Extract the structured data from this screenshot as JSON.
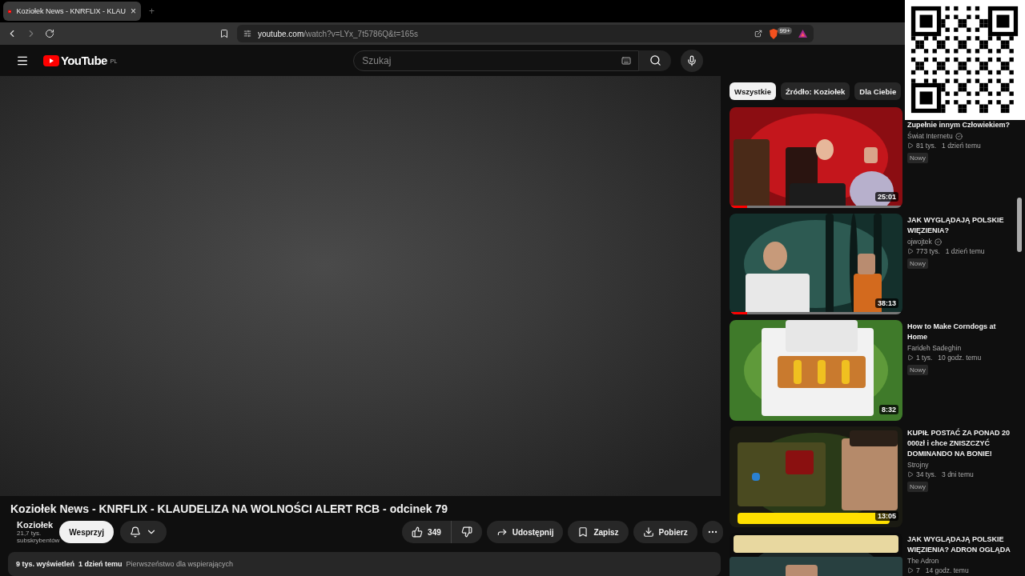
{
  "browser": {
    "tab": {
      "title": "Koziołek News - KNRFLIX - KLAU",
      "close": "×"
    },
    "new_tab": "+",
    "url": {
      "host": "youtube.com",
      "path": "/watch?v=LYx_7t5786Q&t=165s"
    },
    "shield_badge": "99+"
  },
  "header": {
    "logo": "YouTube",
    "region": "PL",
    "search": {
      "placeholder": "Szukaj"
    }
  },
  "video": {
    "title": "Koziołek News - KNRFLIX - KLAUDELIZA NA WOLNOŚCI ALERT RCB - odcinek 79",
    "channel": "Koziołek",
    "subscribers": "21,7 tys. subskrybentów",
    "support": "Wesprzyj",
    "likes": "349",
    "actions": [
      "Udostępnij",
      "Zapisz",
      "Pobierz"
    ],
    "views": "9 tys. wyświetleń",
    "date": "1 dzień temu",
    "note": "Pierwszeństwo dla wspierających"
  },
  "chips": [
    {
      "label": "Wszystkie",
      "selected": true
    },
    {
      "label": "Źródło: Koziołek",
      "selected": false
    },
    {
      "label": "Dla Ciebie",
      "selected": false
    }
  ],
  "recommendations": [
    {
      "title": "Zupełnie innym Człowiekiem?",
      "channel": "Świat Internetu",
      "verified": true,
      "views": "81 tys.",
      "age": "1 dzień temu",
      "badge": "Nowy",
      "duration": "25:01",
      "level": 0.1
    },
    {
      "title": "JAK WYGLĄDAJĄ POLSKIE WIĘZIENIA?",
      "channel": "ojwojtek",
      "verified": true,
      "views": "773 tys.",
      "age": "1 dzień temu",
      "badge": "Nowy",
      "duration": "38:13",
      "level": 0.1
    },
    {
      "title": "How to Make Corndogs at Home",
      "channel": "Farideh Sadeghin",
      "verified": false,
      "views": "1 tys.",
      "age": "10 godz. temu",
      "badge": "Nowy",
      "duration": "8:32"
    },
    {
      "title": "KUPIŁ POSTAĆ ZA PONAD 20 000zł i chce ZNISZCZYĆ DOMINANDO NA BONIE!",
      "channel": "Strojny",
      "verified": false,
      "views": "34 tys.",
      "age": "3 dni temu",
      "badge": "Nowy",
      "duration": "13:05"
    },
    {
      "title": "JAK WYGLĄDAJĄ POLSKIE WIĘZIENIA? ADRON OGLĄDA",
      "channel": "The Adron",
      "verified": false,
      "views": "7",
      "age": "14 godz. temu"
    }
  ]
}
